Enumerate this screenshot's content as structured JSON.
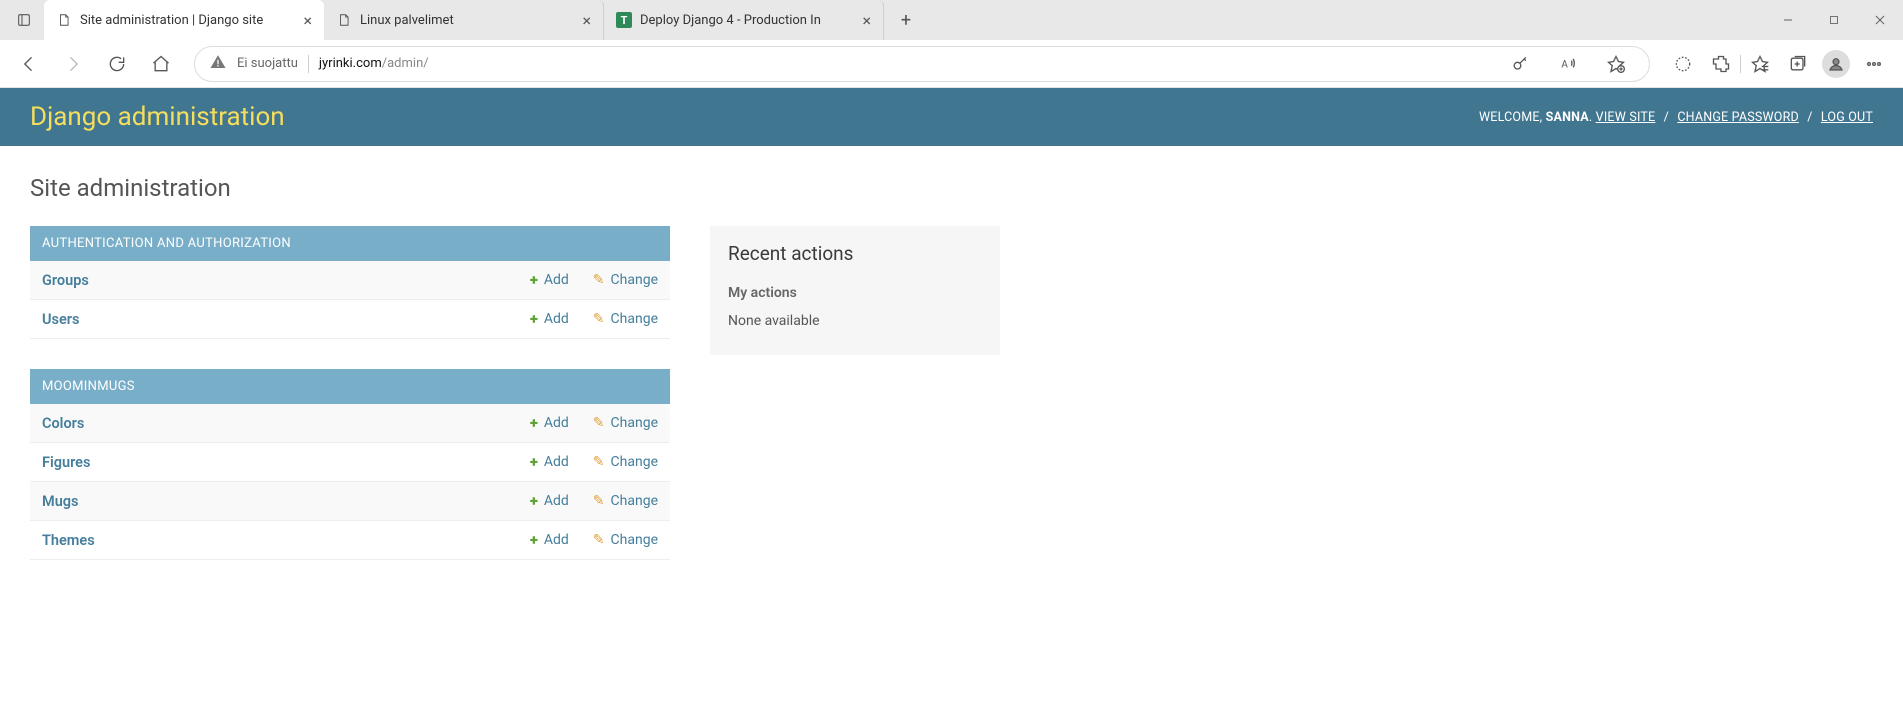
{
  "browser": {
    "tabs": [
      {
        "title": "Site administration | Django site",
        "favicon": "page",
        "active": true
      },
      {
        "title": "Linux palvelimet",
        "favicon": "page",
        "active": false
      },
      {
        "title": "Deploy Django 4 - Production In",
        "favicon": "t",
        "active": false
      }
    ],
    "security_label": "Ei suojattu",
    "url_host": "jyrinki.com",
    "url_path": "/admin/"
  },
  "django": {
    "brand": "Django administration",
    "welcome_label": "WELCOME, ",
    "user": "SANNA",
    "period": ". ",
    "view_site": "VIEW SITE",
    "change_password": "CHANGE PASSWORD",
    "log_out": "LOG OUT",
    "slash": " / ",
    "page_title": "Site administration",
    "add_label": "Add",
    "change_label": "Change",
    "modules": [
      {
        "caption": "AUTHENTICATION AND AUTHORIZATION",
        "models": [
          "Groups",
          "Users"
        ]
      },
      {
        "caption": "MOOMINMUGS",
        "models": [
          "Colors",
          "Figures",
          "Mugs",
          "Themes"
        ]
      }
    ],
    "sidebar": {
      "title": "Recent actions",
      "subtitle": "My actions",
      "none": "None available"
    }
  }
}
